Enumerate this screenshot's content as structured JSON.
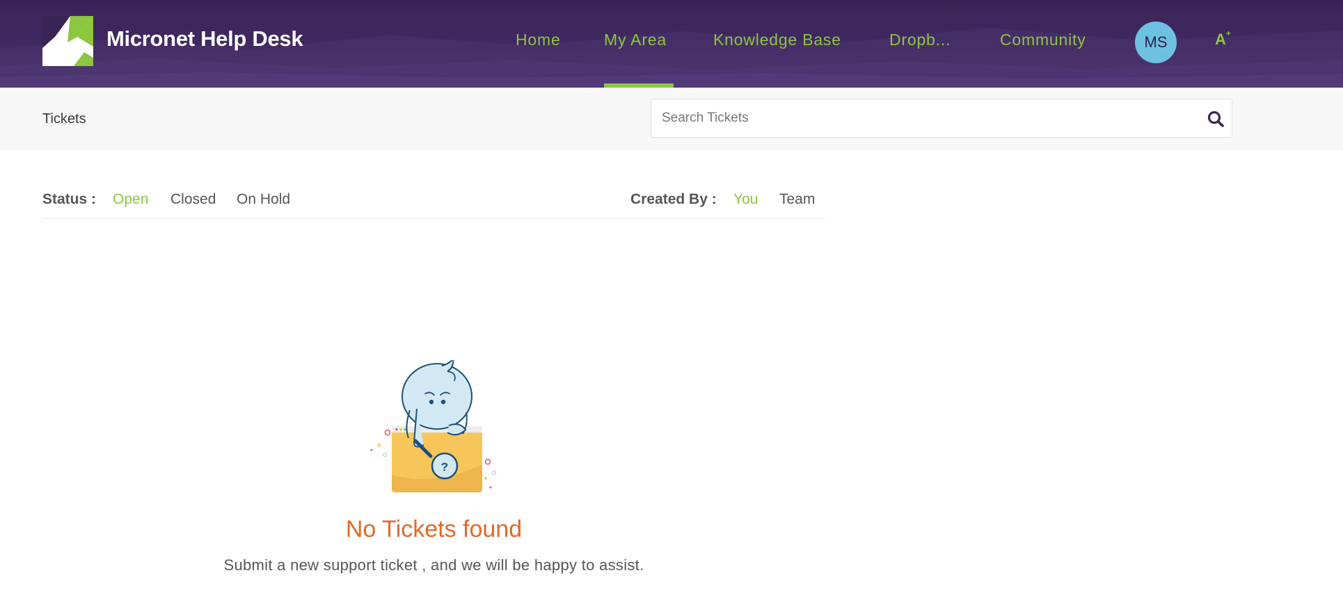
{
  "header": {
    "brand": "Micronet Help Desk",
    "nav": [
      {
        "label": "Home",
        "active": false
      },
      {
        "label": "My Area",
        "active": true
      },
      {
        "label": "Knowledge Base",
        "active": false
      },
      {
        "label": "Dropb...",
        "active": false
      },
      {
        "label": "Community",
        "active": false
      }
    ],
    "avatar_initials": "MS",
    "accessibility_label": "A",
    "accessibility_sup": "+",
    "icons": {
      "logo": "micronet-logo",
      "accessibility": "text-size-icon"
    }
  },
  "subbar": {
    "title": "Tickets",
    "search": {
      "placeholder": "Search Tickets",
      "value": "",
      "icon": "search-icon"
    }
  },
  "filters": {
    "status_label": "Status :",
    "status_options": [
      {
        "label": "Open",
        "active": true
      },
      {
        "label": "Closed",
        "active": false
      },
      {
        "label": "On Hold",
        "active": false
      }
    ],
    "created_by_label": "Created By :",
    "created_by_options": [
      {
        "label": "You",
        "active": true
      },
      {
        "label": "Team",
        "active": false
      }
    ]
  },
  "empty_state": {
    "illustration": "sad-character-magnifier-icon",
    "question_mark": "?",
    "title": "No Tickets found",
    "subtitle": "Submit a new support ticket , and we will be happy to assist."
  },
  "colors": {
    "header_bg": "#3f2860",
    "accent_green": "#8dc63f",
    "empty_title": "#e06a28",
    "avatar_bg": "#6fc1e2"
  }
}
